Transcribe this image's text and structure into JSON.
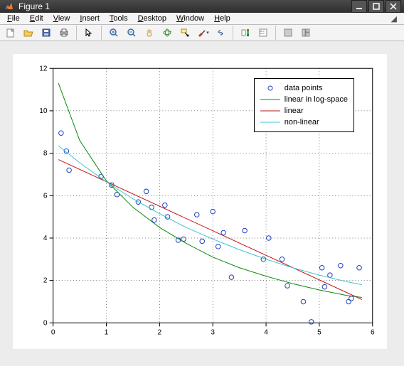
{
  "window": {
    "title": "Figure 1"
  },
  "menu": {
    "file": "File",
    "edit": "Edit",
    "view": "View",
    "insert": "Insert",
    "tools": "Tools",
    "desktop": "Desktop",
    "window": "Window",
    "help": "Help"
  },
  "toolbar_icons": {
    "new": "new",
    "open": "open",
    "save": "save",
    "print": "print",
    "pointer": "pointer",
    "zoomin": "zoom-in",
    "zoomout": "zoom-out",
    "pan": "pan",
    "rotate": "rotate",
    "datacursor": "data-cursor",
    "brush": "brush",
    "link": "link",
    "colorbar": "colorbar",
    "legend": "legend",
    "hide": "hide-tools",
    "dock": "dock"
  },
  "legend": {
    "points": "data points",
    "logspace": "linear in log-space",
    "linear": "linear",
    "nonlinear": "non-linear"
  },
  "chart_data": {
    "type": "scatter",
    "xlabel": "",
    "ylabel": "",
    "xlim": [
      0,
      6
    ],
    "ylim": [
      0,
      12
    ],
    "xticks": [
      0,
      1,
      2,
      3,
      4,
      5,
      6
    ],
    "yticks": [
      0,
      2,
      4,
      6,
      8,
      10,
      12
    ],
    "grid": true,
    "series": [
      {
        "name": "data points",
        "type": "scatter",
        "color": "#1f3fbf",
        "x": [
          0.15,
          0.25,
          0.3,
          0.9,
          1.1,
          1.2,
          1.6,
          1.75,
          1.85,
          1.9,
          2.1,
          2.15,
          2.35,
          2.45,
          2.7,
          2.8,
          3.0,
          3.1,
          3.2,
          3.35,
          3.6,
          3.95,
          4.05,
          4.3,
          4.4,
          4.7,
          4.85,
          5.05,
          5.1,
          5.2,
          5.4,
          5.55,
          5.6,
          5.75
        ],
        "y": [
          8.95,
          8.1,
          7.2,
          6.9,
          6.5,
          6.05,
          5.7,
          6.2,
          5.45,
          4.85,
          5.55,
          5.0,
          3.9,
          3.95,
          5.1,
          3.85,
          5.25,
          3.6,
          4.25,
          2.15,
          4.35,
          3.0,
          4.0,
          3.0,
          1.75,
          1.0,
          0.05,
          2.6,
          1.7,
          2.25,
          2.7,
          1.0,
          1.15,
          2.6
        ]
      },
      {
        "name": "linear in log-space",
        "type": "line",
        "color": "#0b8a0b",
        "x": [
          0.1,
          0.5,
          1.0,
          1.5,
          2.0,
          2.5,
          3.0,
          3.5,
          4.0,
          4.5,
          5.0,
          5.5,
          5.8
        ],
        "y": [
          11.3,
          8.6,
          6.7,
          5.45,
          4.5,
          3.75,
          3.1,
          2.6,
          2.2,
          1.85,
          1.55,
          1.3,
          1.2
        ]
      },
      {
        "name": "linear",
        "type": "line",
        "color": "#c01515",
        "x": [
          0.1,
          5.8
        ],
        "y": [
          7.7,
          1.1
        ]
      },
      {
        "name": "non-linear",
        "type": "line",
        "color": "#3fc3d3",
        "x": [
          0.1,
          0.5,
          1.0,
          1.5,
          2.0,
          2.5,
          3.0,
          3.5,
          4.0,
          4.5,
          5.0,
          5.5,
          5.8
        ],
        "y": [
          8.35,
          7.55,
          6.65,
          5.85,
          5.15,
          4.5,
          3.95,
          3.45,
          3.0,
          2.6,
          2.25,
          1.95,
          1.8
        ]
      }
    ]
  }
}
